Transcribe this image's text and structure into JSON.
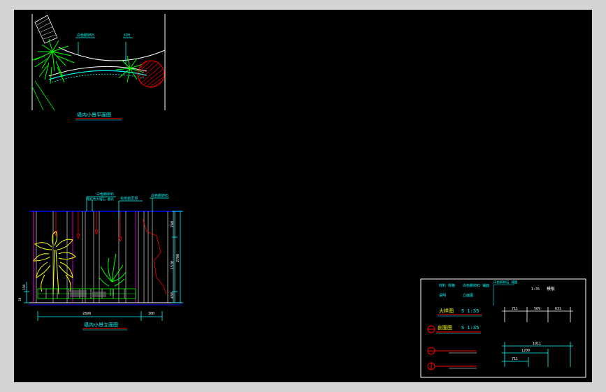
{
  "plan_view": {
    "title": "墙内小景平面图",
    "callout_1": "白色鹅卵石",
    "callout_2": "红叶"
  },
  "elevation_view": {
    "title": "墙内小景立面图",
    "callout_1": "白色鹅卵石",
    "callout_2": "暗红色大理石 磨光",
    "callout_3": "花岗岩压顶",
    "callout_4": "白色鹅卵石",
    "callout_5": "",
    "dim_total_width": "2890",
    "dim_right_width": "300",
    "dim_height_total": "2700",
    "dim_height_top": "740",
    "dim_height_mid": "1530",
    "dim_height_bottom": "430",
    "dim_left_a": "150",
    "dim_left_b": "38"
  },
  "legend": {
    "row1_col1": "材料 规格",
    "row1_col2": "白色鹅卵石 铺面",
    "row1_col3": "白色鹅卵石 铺面",
    "row2_col1": "说明",
    "row2_col2": "立面图",
    "scale_label": "1:35",
    "scale_word": "模板",
    "detail_label": "大样图",
    "detail_scale": "S 1:35",
    "section_label": "剖面图",
    "section_scale": "S 1:35",
    "dim_711": "711",
    "dim_569": "569",
    "dim_631": "631",
    "dim_1911": "1911",
    "dim_1200": "1200",
    "dim_711b": "711"
  },
  "colors": {
    "background": "#000000",
    "outer": "#d4d4d4",
    "cyan": "#00ffff",
    "white": "#ffffff",
    "red": "#ff0000",
    "yellow": "#ffff00",
    "green": "#00ff00",
    "magenta": "#ff00ff",
    "blue": "#0000ff"
  }
}
